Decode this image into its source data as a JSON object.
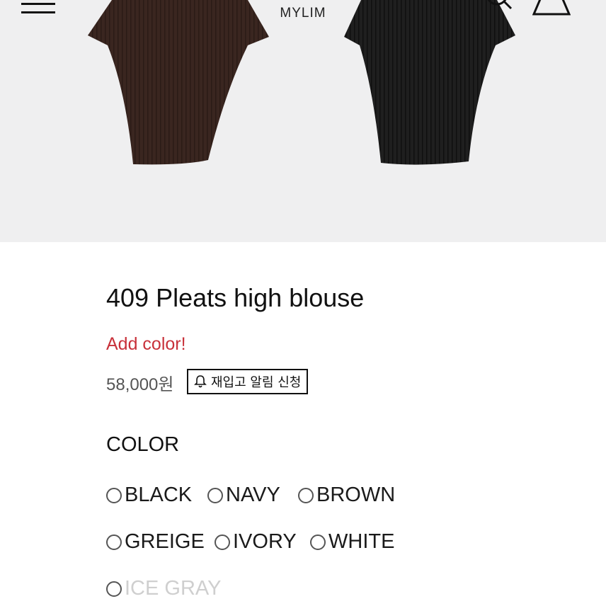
{
  "header": {
    "brand": "MYLIM",
    "menu_icon": "hamburger-menu-icon",
    "search_icon": "search-icon",
    "bag_icon": "shopping-bag-icon"
  },
  "gallery": {
    "images": [
      {
        "name": "brown-blouse-image",
        "color": "#3a2620"
      },
      {
        "name": "black-blouse-image",
        "color": "#1c1c1c"
      }
    ],
    "background": "#efeff0"
  },
  "product": {
    "title": "409 Pleats high blouse",
    "notice": "Add color!",
    "notice_color": "#c8313a",
    "price": "58,000원",
    "restock_label": "재입고 알림 신청",
    "restock_icon": "bell-icon"
  },
  "options": {
    "label": "COLOR",
    "colors": [
      {
        "label": "BLACK",
        "available": true
      },
      {
        "label": "NAVY",
        "available": true
      },
      {
        "label": "BROWN",
        "available": true
      },
      {
        "label": "GREIGE",
        "available": true
      },
      {
        "label": "IVORY",
        "available": true
      },
      {
        "label": "WHITE",
        "available": true
      },
      {
        "label": "ICE GRAY",
        "available": false
      }
    ]
  }
}
